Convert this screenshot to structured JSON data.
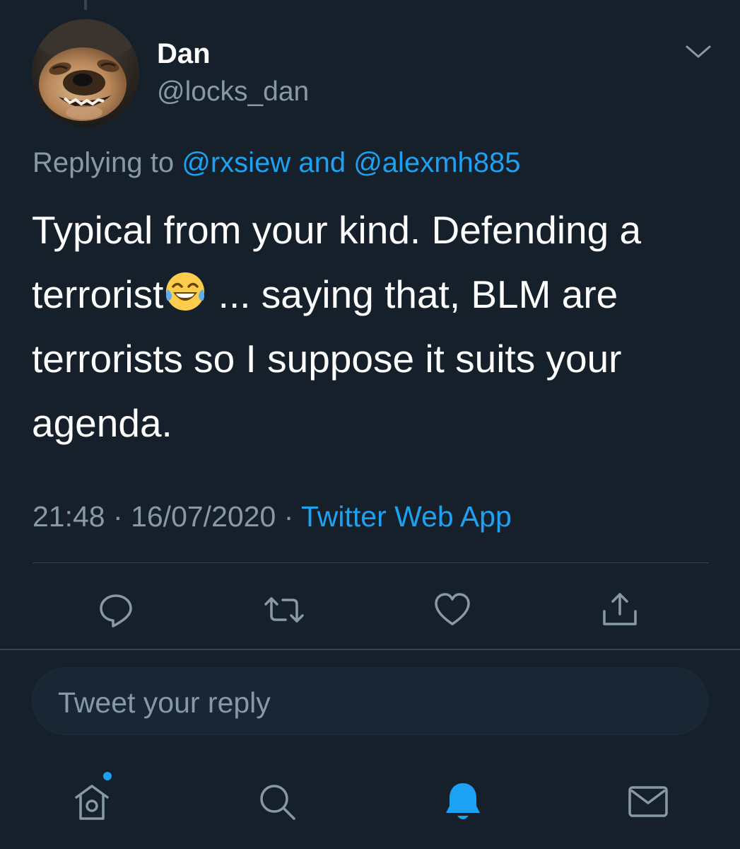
{
  "tweet": {
    "author": {
      "display_name": "Dan",
      "handle": "@locks_dan",
      "avatar": "avatar-photo"
    },
    "replying_to": {
      "prefix": "Replying to",
      "mentions": [
        "@rxsiew",
        "@alexmh885"
      ],
      "joiner": "and"
    },
    "text_lines": [
      "Typical from your kind. Defending a",
      "terrorist",
      " ... saying that, BLM are",
      "terrorists so I suppose it suits your",
      "agenda."
    ],
    "emoji": "face-with-tears-of-joy",
    "time": "21:48",
    "date": "16/07/2020",
    "separator": "·",
    "source": "Twitter Web App"
  },
  "actions": [
    {
      "name": "reply",
      "icon": "reply-icon"
    },
    {
      "name": "retweet",
      "icon": "retweet-icon"
    },
    {
      "name": "like",
      "icon": "heart-icon"
    },
    {
      "name": "share",
      "icon": "share-icon"
    }
  ],
  "reply_box": {
    "placeholder": "Tweet your reply"
  },
  "tabbar": [
    {
      "name": "home",
      "icon": "home-icon",
      "active": false,
      "badge_dot": true
    },
    {
      "name": "search",
      "icon": "search-icon",
      "active": false
    },
    {
      "name": "notifications",
      "icon": "bell-icon",
      "active": true
    },
    {
      "name": "messages",
      "icon": "mail-icon",
      "active": false
    }
  ],
  "colors": {
    "background": "#15202b",
    "accent": "#1da1f2",
    "secondary_text": "#8899a6",
    "divider": "#38444d",
    "input_background": "#192734"
  }
}
